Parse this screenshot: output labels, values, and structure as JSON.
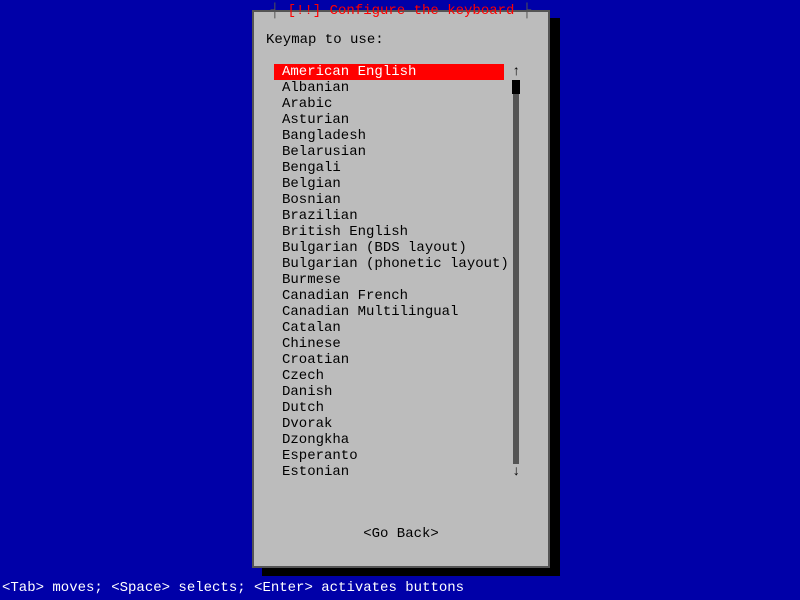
{
  "dialog": {
    "title_prefix": "┤ ",
    "title_marker": "[!!]",
    "title_text": " Configure the keyboard",
    "title_suffix": " ├",
    "prompt": "Keymap to use:",
    "go_back": "<Go Back>"
  },
  "keymaps": [
    "American English",
    "Albanian",
    "Arabic",
    "Asturian",
    "Bangladesh",
    "Belarusian",
    "Bengali",
    "Belgian",
    "Bosnian",
    "Brazilian",
    "British English",
    "Bulgarian (BDS layout)",
    "Bulgarian (phonetic layout)",
    "Burmese",
    "Canadian French",
    "Canadian Multilingual",
    "Catalan",
    "Chinese",
    "Croatian",
    "Czech",
    "Danish",
    "Dutch",
    "Dvorak",
    "Dzongkha",
    "Esperanto",
    "Estonian"
  ],
  "selected_index": 0,
  "scroll": {
    "up": "↑",
    "down": "↓"
  },
  "hint": "<Tab> moves; <Space> selects; <Enter> activates buttons"
}
